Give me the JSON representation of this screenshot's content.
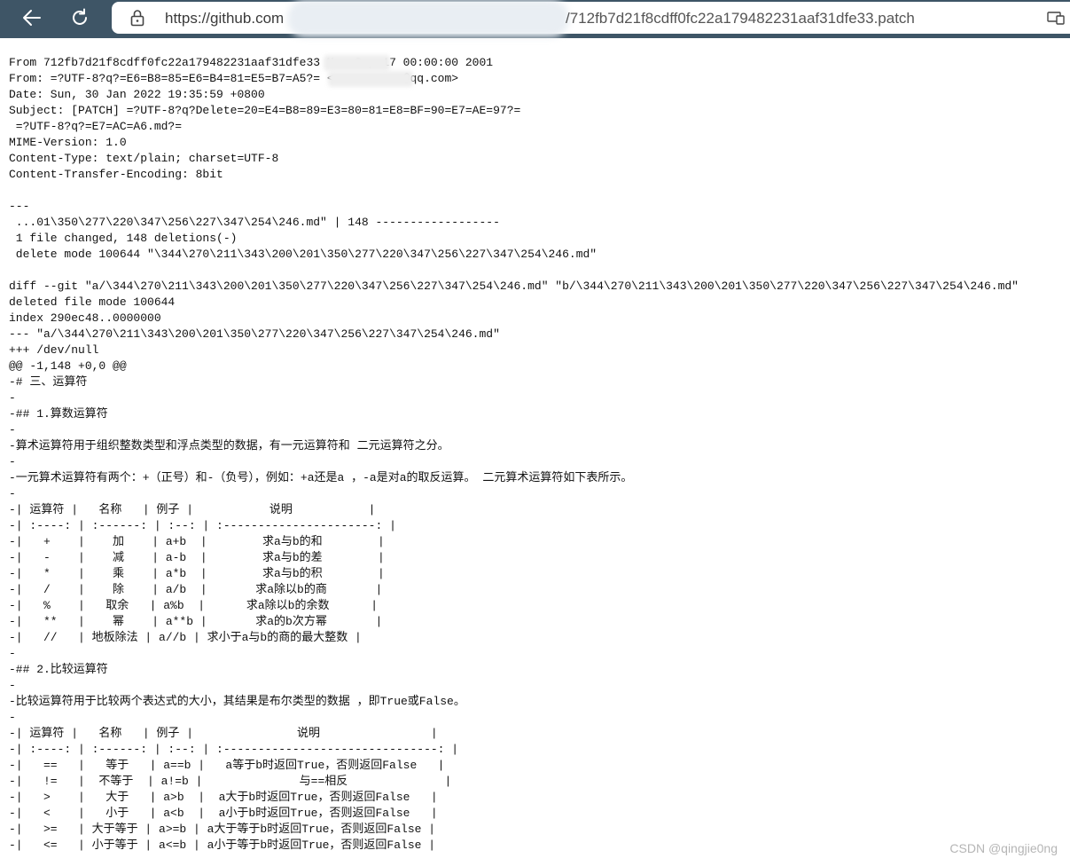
{
  "browser": {
    "url_host": "https://github.com",
    "url_path": "/712fb7d21f8cdff0fc22a179482231aaf31dfe33.patch"
  },
  "patch_lines": [
    "From 712fb7d21f8cdff0fc22a179482231aaf31dfe33 Mon Sep 17 00:00:00 2001",
    "From: =?UTF-8?q?=E6=B8=85=E6=B4=81=E5=B7=A5?= <          @qq.com>",
    "Date: Sun, 30 Jan 2022 19:35:59 +0800",
    "Subject: [PATCH] =?UTF-8?q?Delete=20=E4=B8=89=E3=80=81=E8=BF=90=E7=AE=97?=",
    " =?UTF-8?q?=E7=AC=A6.md?=",
    "MIME-Version: 1.0",
    "Content-Type: text/plain; charset=UTF-8",
    "Content-Transfer-Encoding: 8bit",
    "",
    "---",
    " ...01\\350\\277\\220\\347\\256\\227\\347\\254\\246.md\" | 148 ------------------",
    " 1 file changed, 148 deletions(-)",
    " delete mode 100644 \"\\344\\270\\211\\343\\200\\201\\350\\277\\220\\347\\256\\227\\347\\254\\246.md\"",
    "",
    "diff --git \"a/\\344\\270\\211\\343\\200\\201\\350\\277\\220\\347\\256\\227\\347\\254\\246.md\" \"b/\\344\\270\\211\\343\\200\\201\\350\\277\\220\\347\\256\\227\\347\\254\\246.md\"",
    "deleted file mode 100644",
    "index 290ec48..0000000",
    "--- \"a/\\344\\270\\211\\343\\200\\201\\350\\277\\220\\347\\256\\227\\347\\254\\246.md\"",
    "+++ /dev/null",
    "@@ -1,148 +0,0 @@",
    "-# 三、运算符",
    "-",
    "-## 1.算数运算符",
    "-",
    "-算术运算符用于组织整数类型和浮点类型的数据，有一元运算符和 二元运算符之分。",
    "-",
    "-一元算术运算符有两个：+（正号）和-（负号），例如：+a还是a ，-a是对a的取反运算。 二元算术运算符如下表所示。",
    "-",
    "-| 运算符 |   名称   | 例子 |           说明           |",
    "-| :----: | :------: | :--: | :----------------------: |",
    "-|   +    |    加    | a+b  |        求a与b的和        |",
    "-|   -    |    减    | a-b  |        求a与b的差        |",
    "-|   *    |    乘    | a*b  |        求a与b的积        |",
    "-|   /    |    除    | a/b  |       求a除以b的商       |",
    "-|   %    |   取余   | a%b  |      求a除以b的余数      |",
    "-|   **   |    幂    | a**b |       求a的b次方幂       |",
    "-|   //   | 地板除法 | a//b | 求小于a与b的商的最大整数 |",
    "-",
    "-## 2.比较运算符",
    "-",
    "-比较运算符用于比较两个表达式的大小，其结果是布尔类型的数据 ，即True或False。",
    "-",
    "-| 运算符 |   名称   | 例子 |               说明                |",
    "-| :----: | :------: | :--: | :-------------------------------: |",
    "-|   ==   |   等于   | a==b |   a等于b时返回True，否则返回False   |",
    "-|   !=   |  不等于  | a!=b |              与==相反              |",
    "-|   >    |   大于   | a>b  |  a大于b时返回True，否则返回False   |",
    "-|   <    |   小于   | a<b  |  a小于b时返回True，否则返回False   |",
    "-|   >=   | 大于等于 | a>=b | a大于等于b时返回True，否则返回False |",
    "-|   <=   | 小于等于 | a<=b | a小于等于b时返回True，否则返回False |"
  ],
  "watermark": "CSDN @qingjie0ng"
}
